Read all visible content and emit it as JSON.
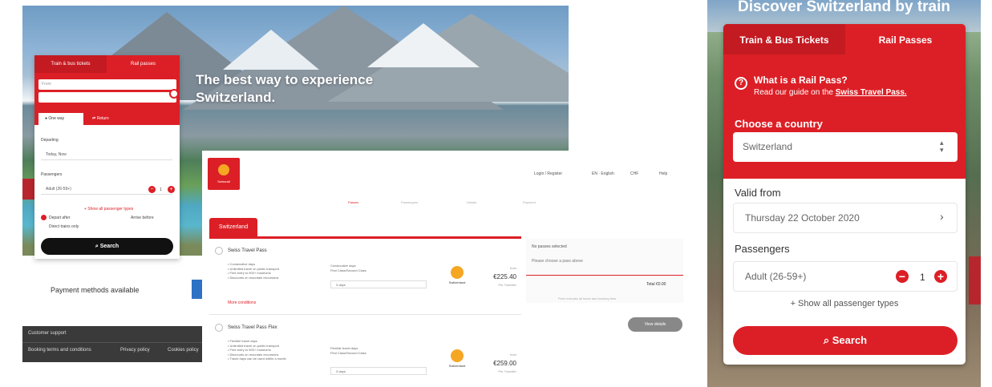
{
  "colors": {
    "brand_red": "#dc1f26",
    "dark": "#111111",
    "footer": "#3a3a3a"
  },
  "desktop": {
    "hero_headline": "The best way to experience Switzerland.",
    "widget": {
      "tabs": [
        "Train & bus tickets",
        "Rail passes"
      ],
      "from_placeholder": "From",
      "to_placeholder": "",
      "trip_types": [
        "One way",
        "Return"
      ],
      "departing_label": "Departing",
      "departing_value": "Today, Now",
      "passengers_label": "Passengers",
      "passenger_value": "Adult (26-59+)",
      "passenger_count": "1",
      "show_all": "+ Show all passenger types",
      "opt_depart": "Depart after",
      "opt_arrive": "Arrive before",
      "opt_direct": "Direct trains only",
      "search": "Search"
    },
    "payment_methods": "Payment methods available",
    "footer": {
      "line1": "Customer support",
      "links": [
        "Booking terms and conditions",
        "Privacy policy",
        "Cookies policy"
      ]
    }
  },
  "results": {
    "logo_text": "Swissrail",
    "nav": [
      "Login / Register",
      "EN · English",
      "CHF",
      "Help"
    ],
    "steps": [
      "Passes",
      "Passengers",
      "Details",
      "Payment"
    ],
    "country_tab": "Switzerland",
    "cards": [
      {
        "title": "Swiss Travel Pass",
        "bullets": "• Consecutive days\n• Unlimited travel on public transport\n• Free entry to 500+ museums\n• Discounts on mountain excursions",
        "info": "Consecutive days\nFirst Class/Second Class",
        "select": "3 days",
        "brand": "Switzerland",
        "price_label": "from",
        "price": "€225.40",
        "price_sub": "Per Traveller"
      },
      {
        "title": "Swiss Travel Pass Flex",
        "bullets": "• Flexible travel days\n• Unlimited travel on public transport\n• Free entry to 500+ museums\n• Discounts on mountain excursions\n• Travel days can be used within a month",
        "info": "Flexible travel days\nFirst Class/Second Class",
        "select": "3 days",
        "brand": "Switzerland",
        "price_label": "from",
        "price": "€259.00",
        "price_sub": "Per Traveller"
      }
    ],
    "more_info": "More conditions",
    "summary": {
      "title": "No passes selected",
      "subtitle": "Please choose a pass above",
      "total": "Total  €0.00",
      "note": "Price includes all taxes and booking fees"
    },
    "view_details": "View details"
  },
  "mobile": {
    "title": "Discover Switzerland by train",
    "tabs": [
      "Train & Bus Tickets",
      "Rail Passes"
    ],
    "help_title": "What is a Rail Pass?",
    "help_text": "Read our guide on the",
    "help_link": "Swiss Travel Pass.",
    "country_label": "Choose a country",
    "country_value": "Switzerland",
    "valid_label": "Valid from",
    "valid_value": "Thursday 22 October 2020",
    "passengers_label": "Passengers",
    "passenger_value": "Adult (26-59+)",
    "passenger_count": "1",
    "show_all": "+ Show all passenger types",
    "search": "Search"
  }
}
